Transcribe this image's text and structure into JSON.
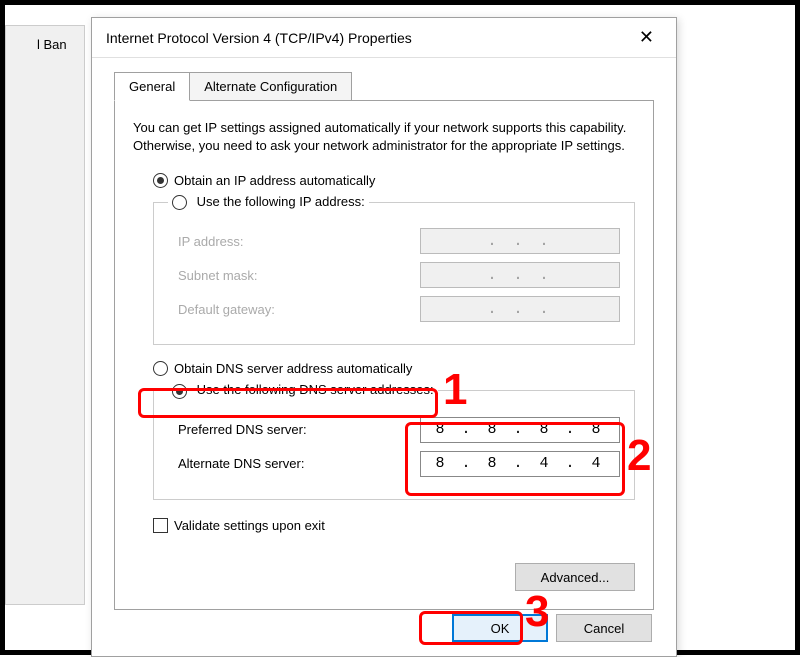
{
  "background": {
    "partial_label": "l Ban"
  },
  "dialog": {
    "title": "Internet Protocol Version 4 (TCP/IPv4) Properties",
    "tabs": {
      "general": "General",
      "alternate": "Alternate Configuration"
    },
    "description": "You can get IP settings assigned automatically if your network supports this capability. Otherwise, you need to ask your network administrator for the appropriate IP settings.",
    "ip_section": {
      "radio_auto": "Obtain an IP address automatically",
      "radio_manual": "Use the following IP address:",
      "ip_address_label": "IP address:",
      "subnet_label": "Subnet mask:",
      "gateway_label": "Default gateway:",
      "placeholder": ".   .   ."
    },
    "dns_section": {
      "radio_auto": "Obtain DNS server address automatically",
      "radio_manual": "Use the following DNS server addresses:",
      "preferred_label": "Preferred DNS server:",
      "alternate_label": "Alternate DNS server:",
      "preferred_value": "8 . 8 . 8 . 8",
      "alternate_value": "8 . 8 . 4 . 4"
    },
    "validate_label": "Validate settings upon exit",
    "advanced_button": "Advanced...",
    "ok_button": "OK",
    "cancel_button": "Cancel"
  },
  "annotations": {
    "n1": "1",
    "n2": "2",
    "n3": "3"
  }
}
